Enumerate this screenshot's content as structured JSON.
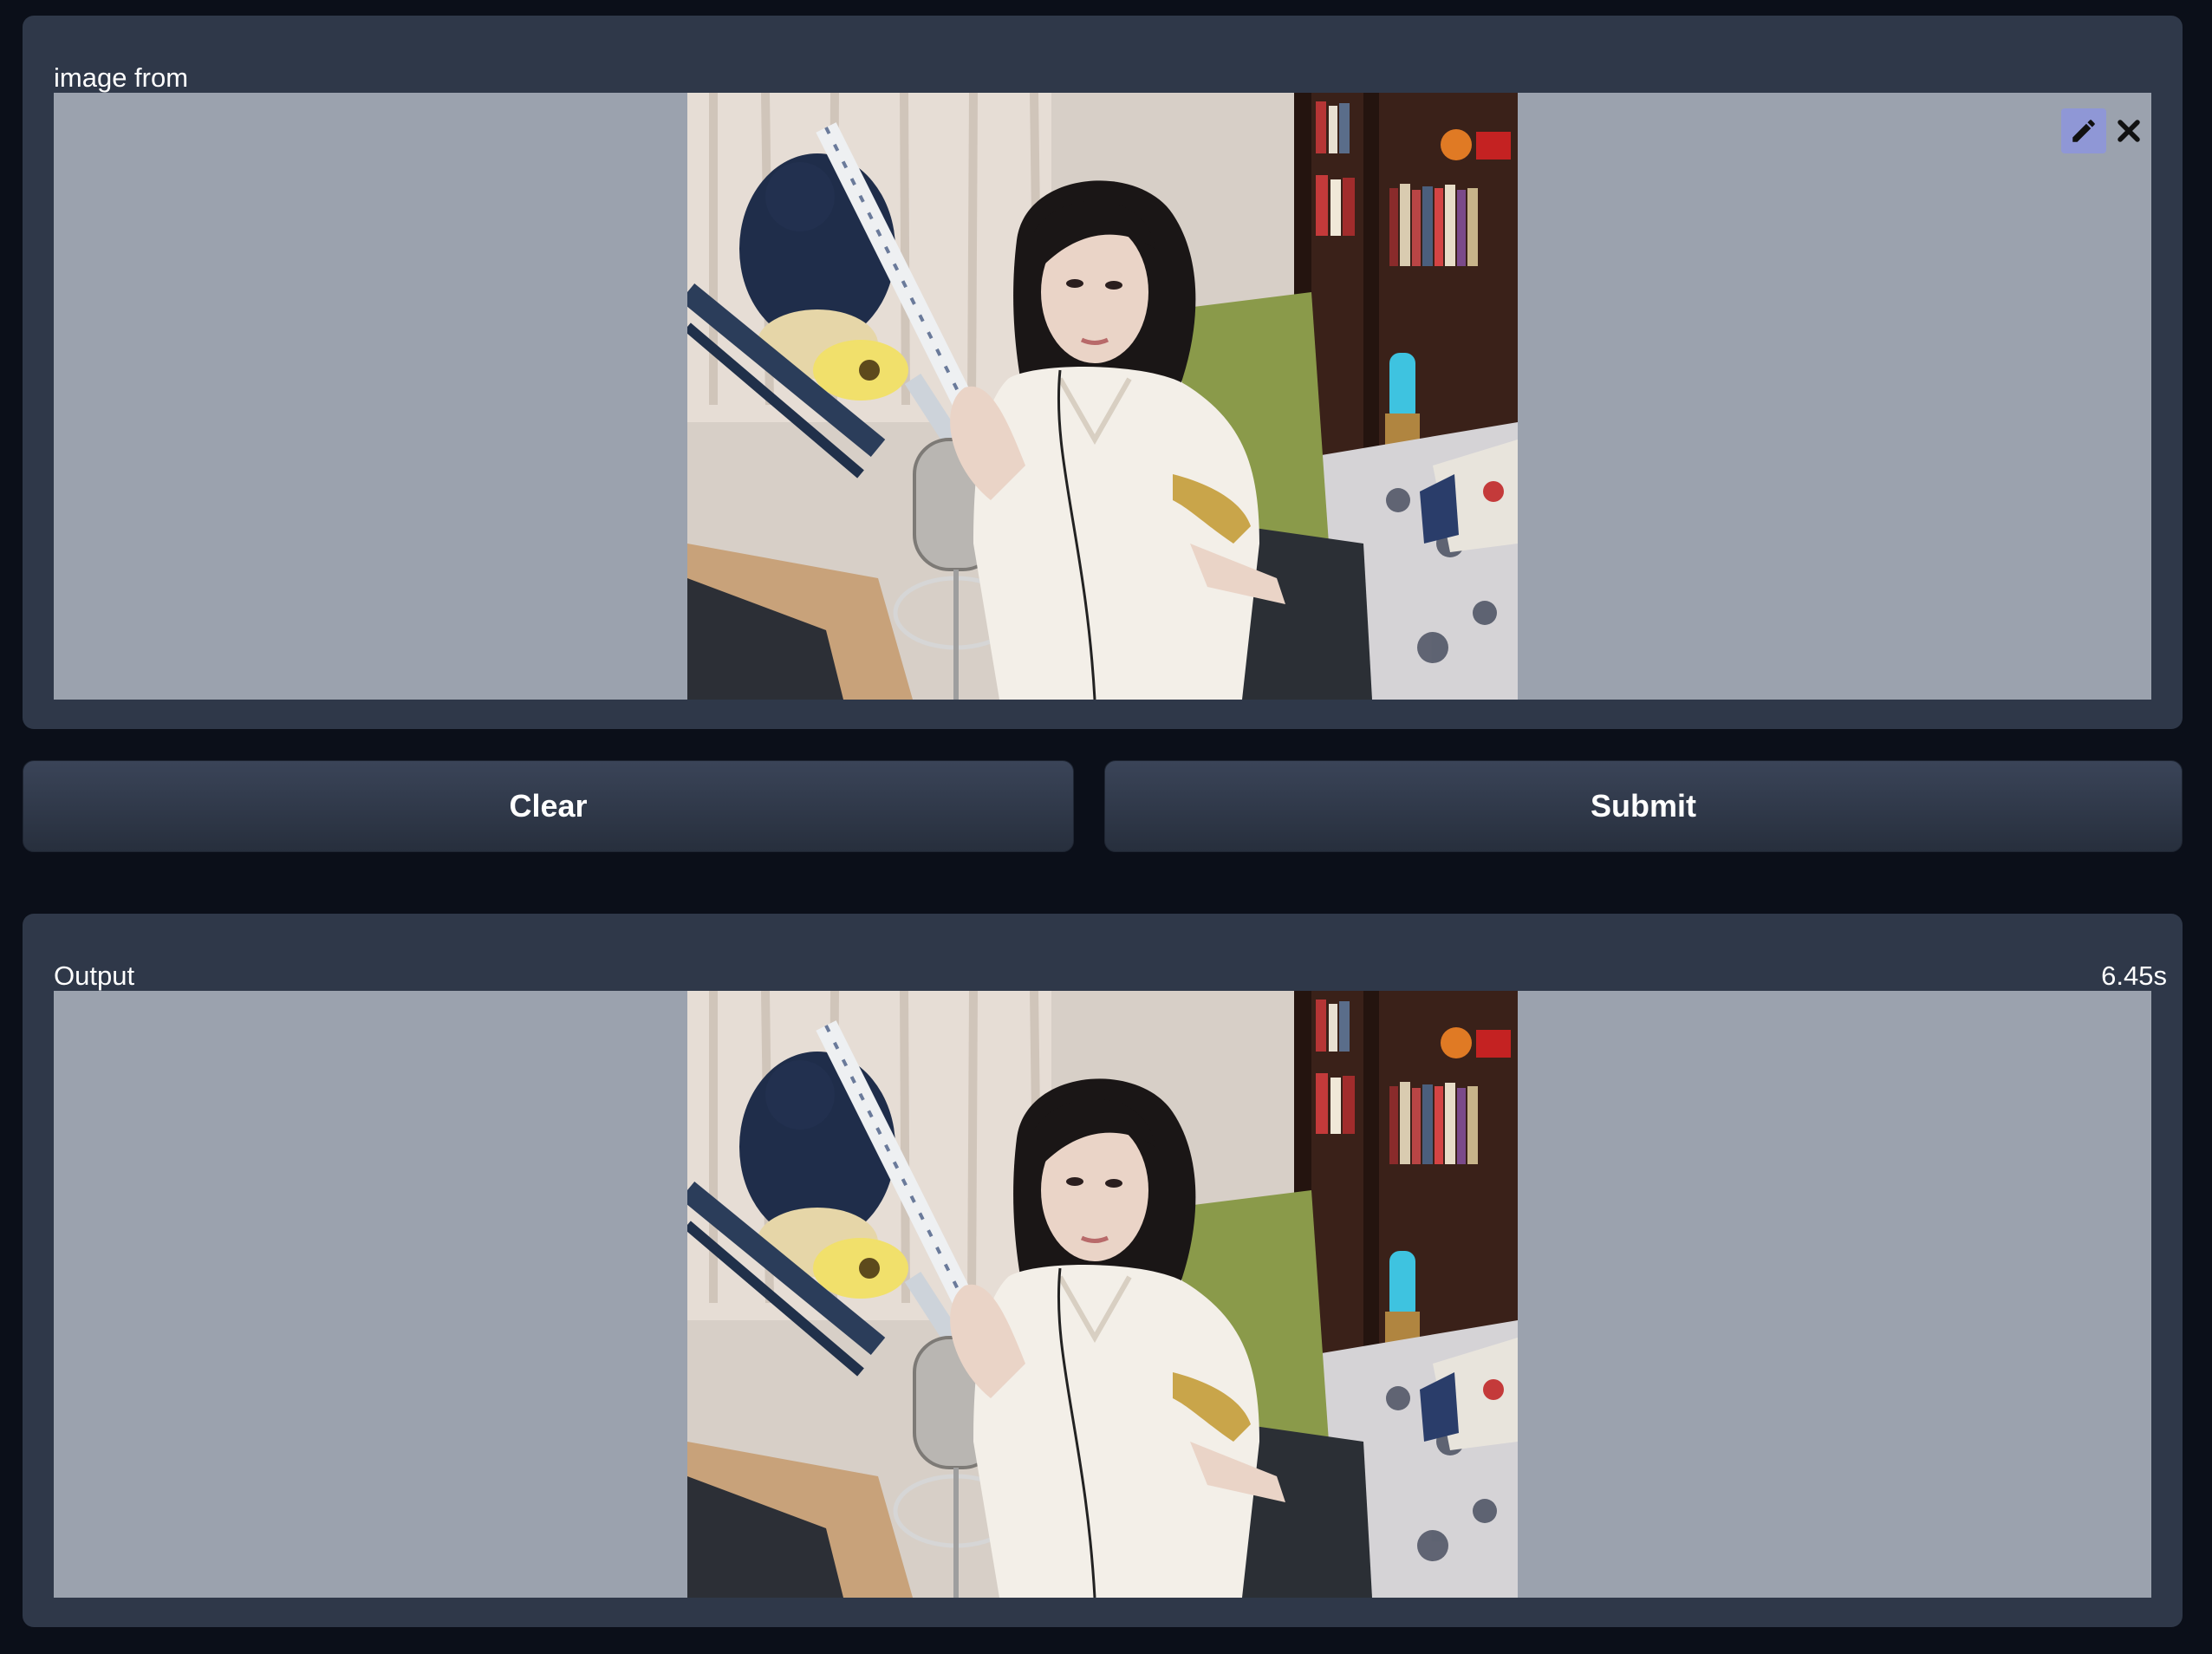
{
  "input_panel": {
    "label": "image from",
    "image_alt": "Webcam frame: woman in white outfit seated at desk with microphone, bookshelves and curtains behind",
    "tools": [
      {
        "icon": "pencil-icon"
      },
      {
        "icon": "close-icon"
      }
    ]
  },
  "actions": {
    "clear_label": "Clear",
    "submit_label": "Submit"
  },
  "output_panel": {
    "label": "Output",
    "elapsed": "6.45s",
    "image_alt": "Processed webcam frame, same scene"
  },
  "colors": {
    "page_background": "#0b0f19",
    "panel_background": "#2f3849",
    "image_background": "#9ba2ae",
    "edit_button": "#8f97d6"
  }
}
